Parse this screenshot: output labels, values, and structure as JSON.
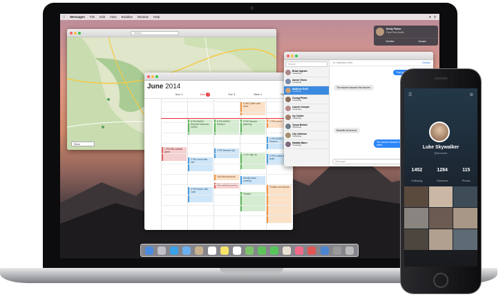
{
  "menubar": {
    "app": "Messages",
    "items": [
      "File",
      "Edit",
      "View",
      "Buddies",
      "Window",
      "Help"
    ]
  },
  "maps": {
    "search_placeholder": "Search",
    "show_label": "Show",
    "buttons": [
      "Map",
      "Satellite"
    ]
  },
  "calendar": {
    "month": "June",
    "year": "2014",
    "days": [
      {
        "label": "Sun",
        "num": "1"
      },
      {
        "label": "Mon",
        "num": "2"
      },
      {
        "label": "Tue",
        "num": "3"
      },
      {
        "label": "Wed",
        "num": "4"
      },
      {
        "label": "Thu",
        "num": "5"
      }
    ],
    "events": [
      {
        "label": "1 PM Ellis softball game",
        "color": "red"
      },
      {
        "label": "8 PM WWDC Keynote Moscone Center",
        "color": "green"
      },
      {
        "label": "8 PM WWDC Session",
        "color": "green"
      },
      {
        "label": "8 PM Session planning",
        "color": "green"
      },
      {
        "label": "9 AM Coffee with team",
        "color": "orange"
      },
      {
        "label": "1 PM Lunch",
        "color": "orange"
      },
      {
        "label": "1 PM WWDC Session",
        "color": "blue"
      },
      {
        "label": "2 PM Lunch with Jeff",
        "color": "blue"
      },
      {
        "label": "3 PM Session QA",
        "color": "blue"
      },
      {
        "label": "3 PM Sign up",
        "color": "green"
      },
      {
        "label": "3 PM Coffee with team",
        "color": "blue"
      },
      {
        "label": "Call with accounts",
        "color": "orange"
      },
      {
        "label": "Ellis softball practice",
        "color": "red"
      },
      {
        "label": "Weekly team meeting",
        "color": "blue"
      },
      {
        "label": "6 PM Dinner with Luke",
        "color": "blue"
      },
      {
        "label": "Theatre",
        "color": "green"
      },
      {
        "label": "Theater and Brunch",
        "color": "orange"
      }
    ]
  },
  "messages": {
    "search_placeholder": "Search",
    "to_label": "To: Matthew Reiff",
    "details": "Details",
    "conversations": [
      {
        "name": "Brian Ingram",
        "preview": "Yesterday"
      },
      {
        "name": "Aaron Gross",
        "preview": "Yesterday"
      },
      {
        "name": "Matthew Reiff",
        "preview": "Yesterday"
      },
      {
        "name": "Cuong Pham",
        "preview": "Yesterday"
      },
      {
        "name": "Lauren Cooper",
        "preview": "Yesterday"
      },
      {
        "name": "Ivy Cullen",
        "preview": "Yesterday"
      },
      {
        "name": "Tyson Bethel",
        "preview": "Yesterday"
      },
      {
        "name": "Lily Calhoun",
        "preview": "Yesterday"
      },
      {
        "name": "Natalia Mann",
        "preview": "Yesterday"
      }
    ],
    "bubbles": [
      {
        "text": "That game was so much fun!",
        "dir": "out"
      },
      {
        "text": "The student became the teacher.",
        "dir": "in"
      },
      {
        "text": "Beautiful all around.",
        "dir": "in"
      },
      {
        "text": "The student became the teacher, and now owes.",
        "dir": "out"
      }
    ],
    "field_placeholder": "iMessage"
  },
  "notification": {
    "name": "Emily Parker",
    "subtitle": "FaceTime Audio",
    "decline": "Decline",
    "accept": "Accept"
  },
  "phone": {
    "name": "Luke Skywalker",
    "username": "@lsosome",
    "stats": [
      {
        "num": "1452",
        "label": "Following"
      },
      {
        "num": "1284",
        "label": "Followers"
      },
      {
        "num": "115",
        "label": "Photos"
      }
    ]
  }
}
